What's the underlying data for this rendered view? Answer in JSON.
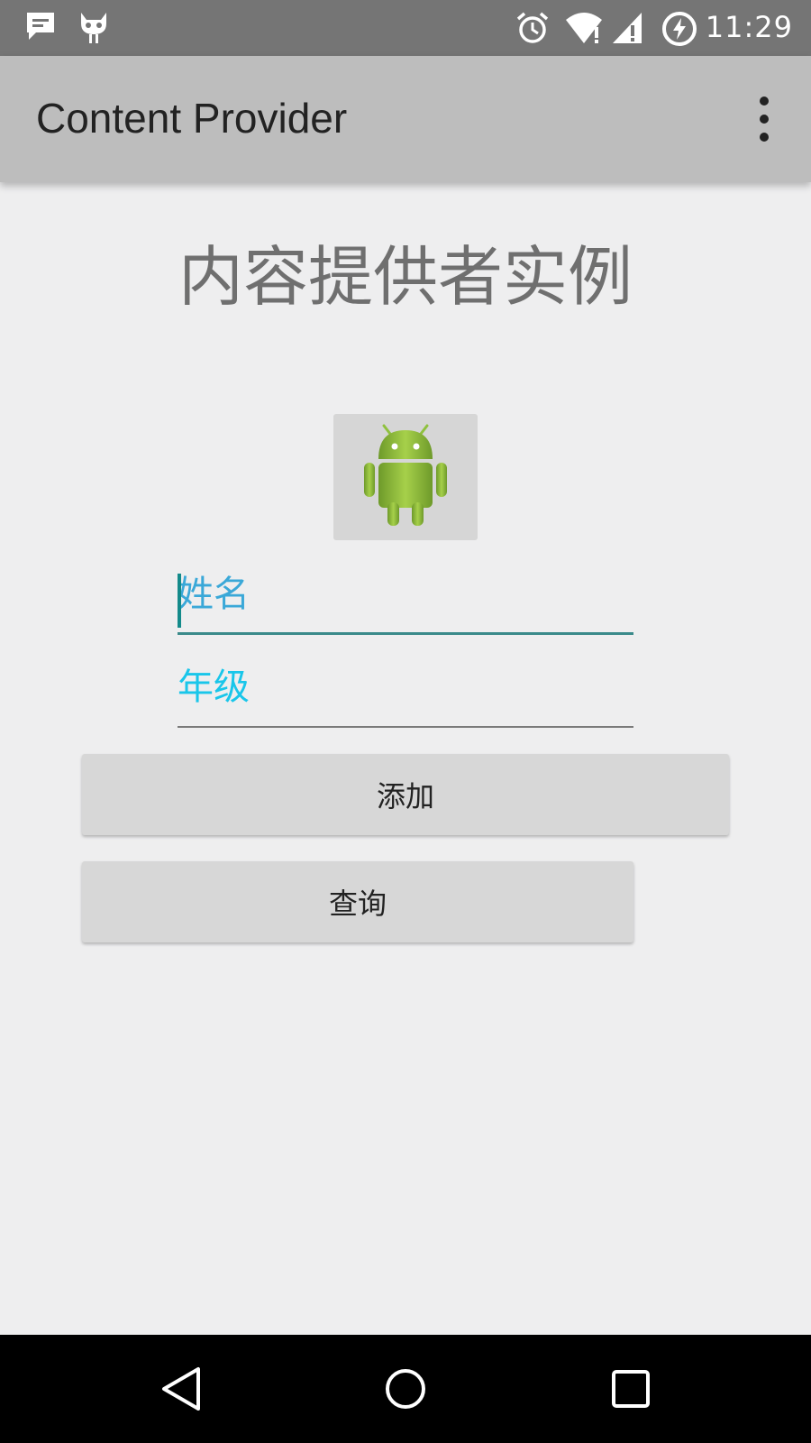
{
  "status_bar": {
    "time": "11:29",
    "icons": [
      "message-icon",
      "cyanogen-icon",
      "alarm-icon",
      "wifi-icon",
      "signal-icon",
      "battery-charging-icon"
    ]
  },
  "app_bar": {
    "title": "Content Provider",
    "overflow_icon": "more-vert-icon"
  },
  "main": {
    "heading": "内容提供者实例",
    "image_button_icon": "android-robot-icon",
    "name_placeholder": "姓名",
    "grade_placeholder": "年级",
    "add_label": "添加",
    "query_label": "查询"
  },
  "nav_bar": {
    "icons": [
      "back-icon",
      "home-icon",
      "recents-icon"
    ]
  },
  "colors": {
    "status_bar": "#757575",
    "app_bar": "#bdbdbd",
    "background": "#eeeeef",
    "accent": "#138a8a",
    "hint_blue": "#3aa8d8",
    "android_green": "#8fc13e"
  }
}
